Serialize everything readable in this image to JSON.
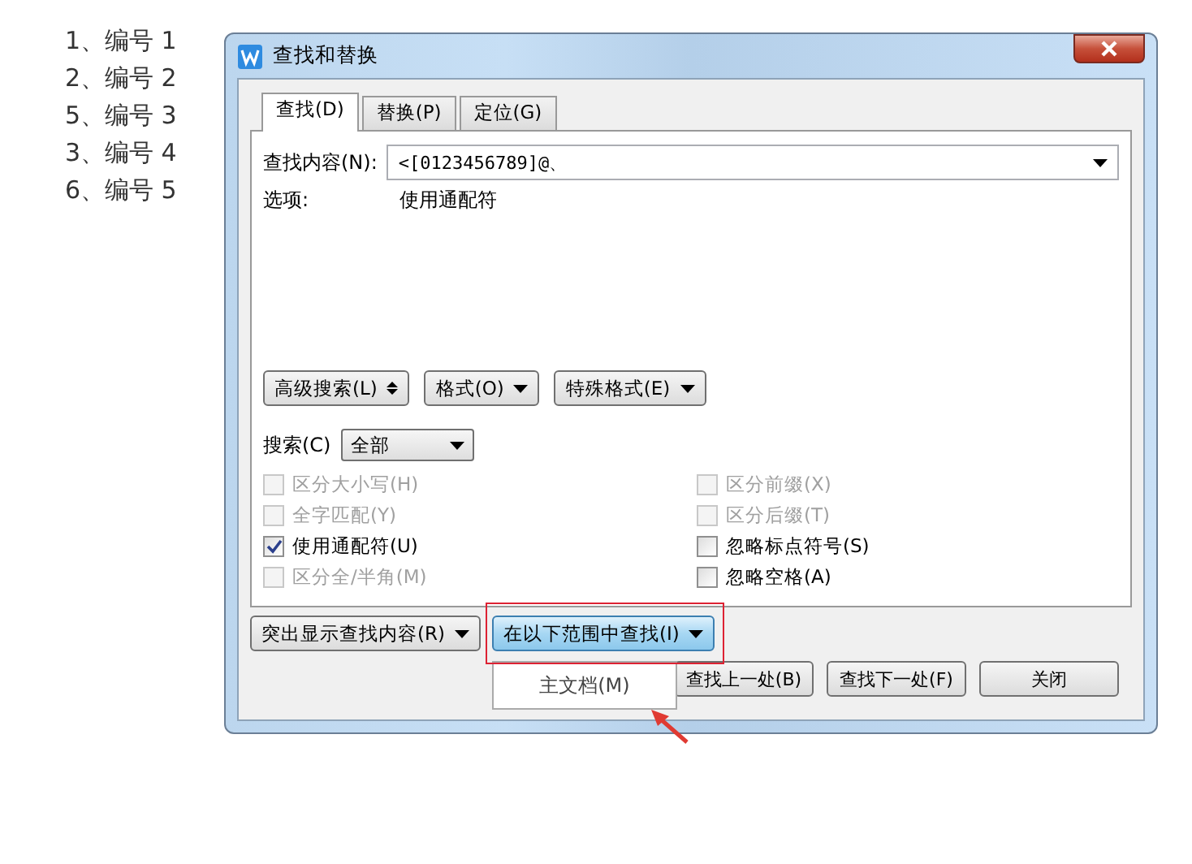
{
  "number_list": [
    "1、编号 1",
    "2、编号 2",
    "5、编号 3",
    "3、编号 4",
    "6、编号 5"
  ],
  "dialog": {
    "title": "查找和替换",
    "tabs": [
      {
        "label": "查找(D)",
        "selected": true
      },
      {
        "label": "替换(P)",
        "selected": false
      },
      {
        "label": "定位(G)",
        "selected": false
      }
    ],
    "find_what": {
      "label": "查找内容(N):",
      "value": "<[0123456789]@、"
    },
    "options": {
      "label": "选项:",
      "value": "使用通配符"
    },
    "format_buttons": [
      {
        "label": "高级搜索(L)",
        "kind": "toggle"
      },
      {
        "label": "格式(O)",
        "kind": "menu"
      },
      {
        "label": "特殊格式(E)",
        "kind": "menu"
      }
    ],
    "search": {
      "label": "搜索(C)",
      "value": "全部"
    },
    "checkboxes_left": [
      {
        "label": "区分大小写(H)",
        "checked": false,
        "disabled": true
      },
      {
        "label": "全字匹配(Y)",
        "checked": false,
        "disabled": true
      },
      {
        "label": "使用通配符(U)",
        "checked": true,
        "disabled": false
      },
      {
        "label": "区分全/半角(M)",
        "checked": false,
        "disabled": true
      }
    ],
    "checkboxes_right": [
      {
        "label": "区分前缀(X)",
        "checked": false,
        "disabled": true
      },
      {
        "label": "区分后缀(T)",
        "checked": false,
        "disabled": true
      },
      {
        "label": "忽略标点符号(S)",
        "checked": false,
        "disabled": false
      },
      {
        "label": "忽略空格(A)",
        "checked": false,
        "disabled": false
      }
    ],
    "highlight_button": {
      "label": "突出显示查找内容(R)"
    },
    "find_in_button": {
      "label": "在以下范围中查找(I)",
      "expanded": true,
      "menu": [
        "主文档(M)"
      ]
    },
    "action_buttons": [
      "查找上一处(B)",
      "查找下一处(F)",
      "关闭"
    ]
  }
}
